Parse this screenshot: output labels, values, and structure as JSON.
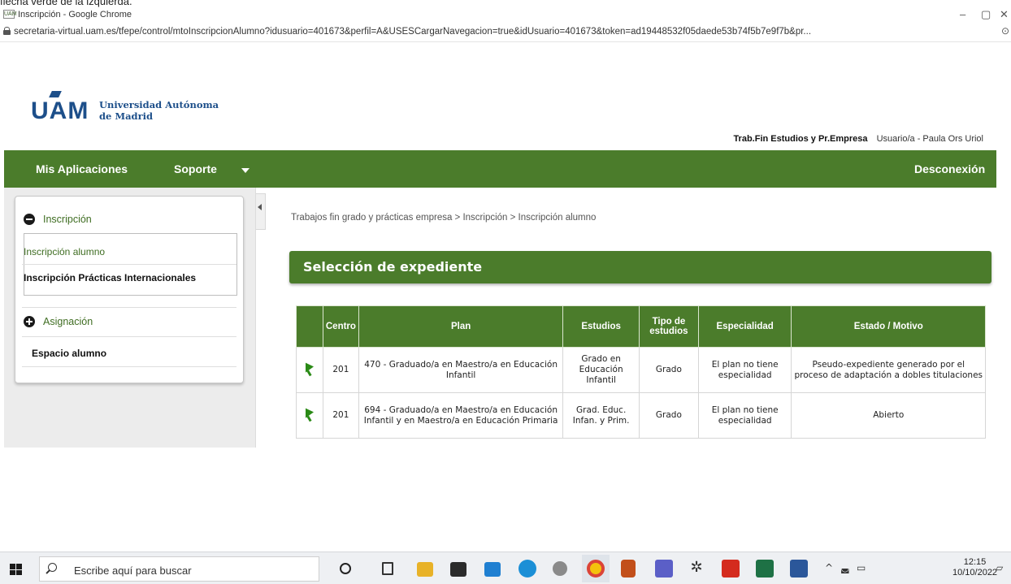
{
  "doc_caption": "flecha verde de la izquierda.",
  "browser": {
    "tab_title": "Inscripción - Google Chrome",
    "favicon_text": "UAM",
    "url": "secretaria-virtual.uam.es/tfepe/control/mtoInscripcionAlumno?idusuario=401673&perfil=A&USESCargarNavegacion=true&idUsuario=401673&token=ad19448532f05daede53b74f5b7e9f7b&pr...",
    "minimize": "–",
    "restore": "▢",
    "close": "✕"
  },
  "header": {
    "logo_mark": "UAM",
    "logo_line1": "Universidad Autónoma",
    "logo_line2": "de Madrid",
    "app_name": "Trab.Fin Estudios y Pr.Empresa",
    "user": "Usuario/a - Paula Ors Uriol"
  },
  "nav": {
    "apps": "Mis Aplicaciones",
    "support": "Soporte",
    "logout": "Desconexión"
  },
  "sidebar": {
    "section1": "Inscripción",
    "item1": "Inscripción alumno",
    "item2": "Inscripción Prácticas Internacionales",
    "section2": "Asignación",
    "item3": "Espacio alumno"
  },
  "main": {
    "breadcrumb": "Trabajos fin grado y prácticas empresa > Inscripción > Inscripción alumno",
    "section_title": "Selección de expediente",
    "columns": [
      "",
      "Centro",
      "Plan",
      "Estudios",
      "Tipo de estudios",
      "Especialidad",
      "Estado / Motivo"
    ],
    "rows": [
      {
        "centro": "201",
        "plan": "470 - Graduado/a en Maestro/a en Educación Infantil",
        "estudios": "Grado en Educación Infantil",
        "tipo": "Grado",
        "especialidad": "El plan no tiene especialidad",
        "estado": "Pseudo-expediente generado por el proceso de adaptación a dobles titulaciones"
      },
      {
        "centro": "201",
        "plan": "694 - Graduado/a en Maestro/a en Educación Infantil y en Maestro/a en Educación Primaria",
        "estudios": "Grad. Educ. Infan. y Prim.",
        "tipo": "Grado",
        "especialidad": "El plan no tiene especialidad",
        "estado": "Abierto"
      }
    ]
  },
  "taskbar": {
    "search_placeholder": "Escribe aquí para buscar",
    "time": "12:15",
    "date": "10/10/2022"
  }
}
